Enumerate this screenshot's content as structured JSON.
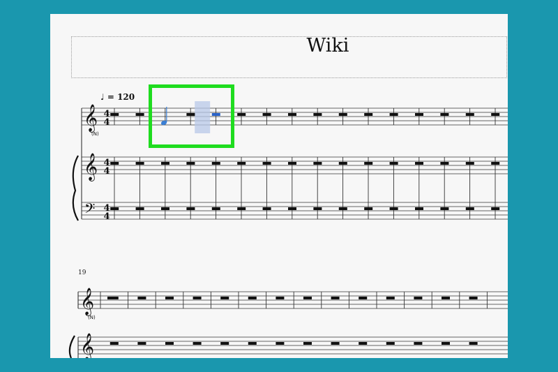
{
  "score": {
    "title": "Wiki",
    "tempo_glyph": "♩",
    "tempo_text": " = 120",
    "second_system_measure_number": "19"
  },
  "colors": {
    "background": "#1a97ae",
    "page": "#f7f7f7",
    "highlight_border": "#1fdc1f",
    "selection_fill": "#b8c8e8",
    "note_color": "#3b7fd4",
    "rest_color": "#2a63c8"
  },
  "icons": {
    "clef_top": "treble-clef-icon",
    "clef_bass": "bass-clef-icon",
    "brace": "grand-staff-brace-icon"
  },
  "time_signature": "4/4"
}
